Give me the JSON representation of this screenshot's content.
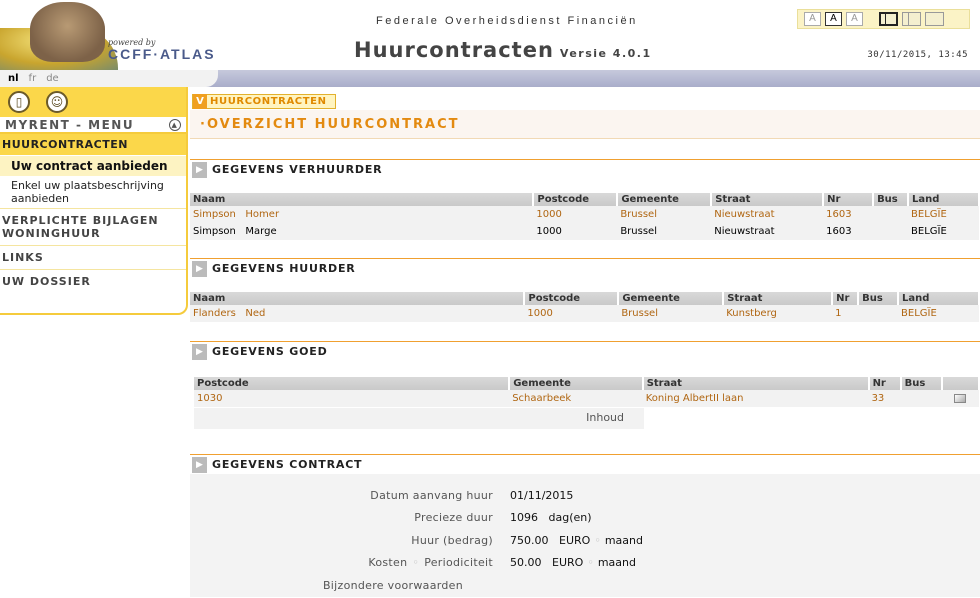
{
  "header": {
    "powered_by": "powered by",
    "brand": "CCFF·ATLAS",
    "agency": "Federale Overheidsdienst Financiën",
    "app_title": "Huurcontracten",
    "version": "Versie 4.0.1",
    "datetime": "30/11/2015, 13:45",
    "font_sizes": [
      "A",
      "A",
      "A"
    ]
  },
  "languages": [
    "nl",
    "fr",
    "de"
  ],
  "sidebar": {
    "menu_title": "MYRENT - MENU",
    "active_group": "HUURCONTRACTEN",
    "sub_items": [
      "Uw contract aanbieden",
      "Enkel uw plaatsbeschrijving aanbieden"
    ],
    "items": [
      "VERPLICHTE BIJLAGEN WONINGHUUR",
      "LINKS",
      "UW DOSSIER"
    ]
  },
  "breadcrumb": "HUURCONTRACTEN",
  "page_title": "·OVERZICHT HUURCONTRACT",
  "verhuurder": {
    "title": "GEGEVENS VERHUURDER",
    "columns": [
      "Naam",
      "Postcode",
      "Gemeente",
      "Straat",
      "Nr",
      "Bus",
      "Land"
    ],
    "rows": [
      [
        "Simpson   Homer",
        "1000",
        "Brussel",
        "Nieuwstraat",
        "1603",
        "",
        "BELGÏE"
      ],
      [
        "Simpson   Marge",
        "1000",
        "Brussel",
        "Nieuwstraat",
        "1603",
        "",
        "BELGÏE"
      ]
    ]
  },
  "huurder": {
    "title": "GEGEVENS HUURDER",
    "columns": [
      "Naam",
      "Postcode",
      "Gemeente",
      "Straat",
      "Nr",
      "Bus",
      "Land"
    ],
    "rows": [
      [
        "Flanders   Ned",
        "1000",
        "Brussel",
        "Kunstberg",
        "1",
        "",
        "BELGÏE"
      ]
    ]
  },
  "goed": {
    "title": "GEGEVENS GOED",
    "columns": [
      "Postcode",
      "Gemeente",
      "Straat",
      "Nr",
      "Bus"
    ],
    "row": [
      "1030",
      "Schaarbeek",
      "Koning AlbertII laan",
      "33",
      ""
    ],
    "inhoud_label": "Inhoud"
  },
  "contract": {
    "title": "GEGEVENS CONTRACT",
    "start_label": "Datum aanvang huur",
    "start_value": "01/11/2015",
    "duration_label": "Precieze duur",
    "duration_value": "1096",
    "duration_unit": "dag(en)",
    "rent_label": "Huur (bedrag)",
    "rent_value": "750.00",
    "rent_currency": "EURO",
    "rent_period": "maand",
    "costs_label": "Kosten",
    "periodicity_label": "Periodiciteit",
    "costs_value": "50.00",
    "costs_currency": "EURO",
    "costs_period": "maand",
    "conditions_label": "Bijzondere voorwaarden",
    "separator": "◦"
  }
}
